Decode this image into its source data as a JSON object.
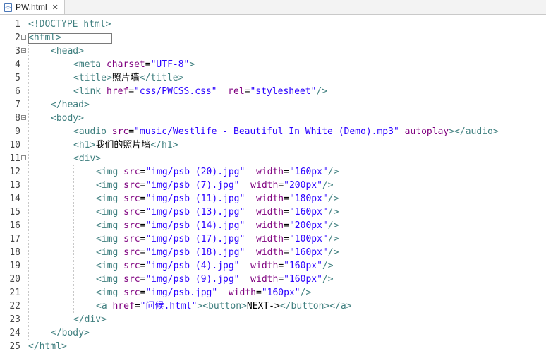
{
  "tab": {
    "filename": "PW.html",
    "icon": "html-file-icon",
    "close": "close-icon"
  },
  "lines": [
    {
      "n": "1",
      "indent": 0,
      "fold": false,
      "tokens": [
        [
          "tag",
          "<!DOCTYPE html>"
        ]
      ]
    },
    {
      "n": "2",
      "indent": 0,
      "fold": true,
      "tokens": [
        [
          "tag",
          "<html>"
        ]
      ]
    },
    {
      "n": "3",
      "indent": 1,
      "fold": true,
      "tokens": [
        [
          "tag",
          "<head>"
        ]
      ]
    },
    {
      "n": "4",
      "indent": 2,
      "fold": false,
      "tokens": [
        [
          "tag",
          "<meta "
        ],
        [
          "attr",
          "charset"
        ],
        [
          "txt",
          "="
        ],
        [
          "val",
          "\"UTF-8\""
        ],
        [
          "tag",
          ">"
        ]
      ]
    },
    {
      "n": "5",
      "indent": 2,
      "fold": false,
      "tokens": [
        [
          "tag",
          "<title>"
        ],
        [
          "txt",
          "照片墙"
        ],
        [
          "tag",
          "</title>"
        ]
      ]
    },
    {
      "n": "6",
      "indent": 2,
      "fold": false,
      "tokens": [
        [
          "tag",
          "<link "
        ],
        [
          "attr",
          "href"
        ],
        [
          "txt",
          "="
        ],
        [
          "val",
          "\"css/PWCSS.css\""
        ],
        [
          "txt",
          "  "
        ],
        [
          "attr",
          "rel"
        ],
        [
          "txt",
          "="
        ],
        [
          "val",
          "\"stylesheet\""
        ],
        [
          "tag",
          "/>"
        ]
      ]
    },
    {
      "n": "7",
      "indent": 1,
      "fold": false,
      "tokens": [
        [
          "tag",
          "</head>"
        ]
      ]
    },
    {
      "n": "8",
      "indent": 1,
      "fold": true,
      "tokens": [
        [
          "tag",
          "<body>"
        ]
      ]
    },
    {
      "n": "9",
      "indent": 2,
      "fold": false,
      "tokens": [
        [
          "tag",
          "<audio "
        ],
        [
          "attr",
          "src"
        ],
        [
          "txt",
          "="
        ],
        [
          "val",
          "\"music/Westlife - Beautiful In White (Demo).mp3\""
        ],
        [
          "txt",
          " "
        ],
        [
          "attr",
          "autoplay"
        ],
        [
          "tag",
          "></audio>"
        ]
      ]
    },
    {
      "n": "10",
      "indent": 2,
      "fold": false,
      "tokens": [
        [
          "tag",
          "<h1>"
        ],
        [
          "txt",
          "我们的照片墙"
        ],
        [
          "tag",
          "</h1>"
        ]
      ]
    },
    {
      "n": "11",
      "indent": 2,
      "fold": true,
      "tokens": [
        [
          "tag",
          "<div>"
        ]
      ]
    },
    {
      "n": "12",
      "indent": 3,
      "fold": false,
      "tokens": [
        [
          "tag",
          "<img "
        ],
        [
          "attr",
          "src"
        ],
        [
          "txt",
          "="
        ],
        [
          "val",
          "\"img/psb (20).jpg\""
        ],
        [
          "txt",
          "  "
        ],
        [
          "attr",
          "width"
        ],
        [
          "txt",
          "="
        ],
        [
          "val",
          "\"160px\""
        ],
        [
          "tag",
          "/>"
        ]
      ]
    },
    {
      "n": "13",
      "indent": 3,
      "fold": false,
      "tokens": [
        [
          "tag",
          "<img "
        ],
        [
          "attr",
          "src"
        ],
        [
          "txt",
          "="
        ],
        [
          "val",
          "\"img/psb (7).jpg\""
        ],
        [
          "txt",
          "  "
        ],
        [
          "attr",
          "width"
        ],
        [
          "txt",
          "="
        ],
        [
          "val",
          "\"200px\""
        ],
        [
          "tag",
          "/>"
        ]
      ]
    },
    {
      "n": "14",
      "indent": 3,
      "fold": false,
      "tokens": [
        [
          "tag",
          "<img "
        ],
        [
          "attr",
          "src"
        ],
        [
          "txt",
          "="
        ],
        [
          "val",
          "\"img/psb (11).jpg\""
        ],
        [
          "txt",
          "  "
        ],
        [
          "attr",
          "width"
        ],
        [
          "txt",
          "="
        ],
        [
          "val",
          "\"180px\""
        ],
        [
          "tag",
          "/>"
        ]
      ]
    },
    {
      "n": "15",
      "indent": 3,
      "fold": false,
      "tokens": [
        [
          "tag",
          "<img "
        ],
        [
          "attr",
          "src"
        ],
        [
          "txt",
          "="
        ],
        [
          "val",
          "\"img/psb (13).jpg\""
        ],
        [
          "txt",
          "  "
        ],
        [
          "attr",
          "width"
        ],
        [
          "txt",
          "="
        ],
        [
          "val",
          "\"160px\""
        ],
        [
          "tag",
          "/>"
        ]
      ]
    },
    {
      "n": "16",
      "indent": 3,
      "fold": false,
      "tokens": [
        [
          "tag",
          "<img "
        ],
        [
          "attr",
          "src"
        ],
        [
          "txt",
          "="
        ],
        [
          "val",
          "\"img/psb (14).jpg\""
        ],
        [
          "txt",
          "  "
        ],
        [
          "attr",
          "width"
        ],
        [
          "txt",
          "="
        ],
        [
          "val",
          "\"200px\""
        ],
        [
          "tag",
          "/>"
        ]
      ]
    },
    {
      "n": "17",
      "indent": 3,
      "fold": false,
      "tokens": [
        [
          "tag",
          "<img "
        ],
        [
          "attr",
          "src"
        ],
        [
          "txt",
          "="
        ],
        [
          "val",
          "\"img/psb (17).jpg\""
        ],
        [
          "txt",
          "  "
        ],
        [
          "attr",
          "width"
        ],
        [
          "txt",
          "="
        ],
        [
          "val",
          "\"100px\""
        ],
        [
          "tag",
          "/>"
        ]
      ]
    },
    {
      "n": "18",
      "indent": 3,
      "fold": false,
      "tokens": [
        [
          "tag",
          "<img "
        ],
        [
          "attr",
          "src"
        ],
        [
          "txt",
          "="
        ],
        [
          "val",
          "\"img/psb (18).jpg\""
        ],
        [
          "txt",
          "  "
        ],
        [
          "attr",
          "width"
        ],
        [
          "txt",
          "="
        ],
        [
          "val",
          "\"160px\""
        ],
        [
          "tag",
          "/>"
        ]
      ]
    },
    {
      "n": "19",
      "indent": 3,
      "fold": false,
      "tokens": [
        [
          "tag",
          "<img "
        ],
        [
          "attr",
          "src"
        ],
        [
          "txt",
          "="
        ],
        [
          "val",
          "\"img/psb (4).jpg\""
        ],
        [
          "txt",
          "  "
        ],
        [
          "attr",
          "width"
        ],
        [
          "txt",
          "="
        ],
        [
          "val",
          "\"160px\""
        ],
        [
          "tag",
          "/>"
        ]
      ]
    },
    {
      "n": "20",
      "indent": 3,
      "fold": false,
      "tokens": [
        [
          "tag",
          "<img "
        ],
        [
          "attr",
          "src"
        ],
        [
          "txt",
          "="
        ],
        [
          "val",
          "\"img/psb (9).jpg\""
        ],
        [
          "txt",
          "  "
        ],
        [
          "attr",
          "width"
        ],
        [
          "txt",
          "="
        ],
        [
          "val",
          "\"160px\""
        ],
        [
          "tag",
          "/>"
        ]
      ]
    },
    {
      "n": "21",
      "indent": 3,
      "fold": false,
      "tokens": [
        [
          "tag",
          "<img "
        ],
        [
          "attr",
          "src"
        ],
        [
          "txt",
          "="
        ],
        [
          "val",
          "\"img/psb.jpg\""
        ],
        [
          "txt",
          "  "
        ],
        [
          "attr",
          "width"
        ],
        [
          "txt",
          "="
        ],
        [
          "val",
          "\"160px\""
        ],
        [
          "tag",
          "/>"
        ]
      ]
    },
    {
      "n": "22",
      "indent": 3,
      "fold": false,
      "tokens": [
        [
          "tag",
          "<a "
        ],
        [
          "attr",
          "href"
        ],
        [
          "txt",
          "="
        ],
        [
          "val",
          "\"问候.html\""
        ],
        [
          "tag",
          "><button>"
        ],
        [
          "txt",
          "NEXT->"
        ],
        [
          "tag",
          "</button></a>"
        ]
      ]
    },
    {
      "n": "23",
      "indent": 2,
      "fold": false,
      "tokens": [
        [
          "tag",
          "</div>"
        ]
      ]
    },
    {
      "n": "24",
      "indent": 1,
      "fold": false,
      "tokens": [
        [
          "tag",
          "</body>"
        ]
      ]
    },
    {
      "n": "25",
      "indent": 0,
      "fold": false,
      "tokens": [
        [
          "tag",
          "</html>"
        ]
      ]
    }
  ]
}
